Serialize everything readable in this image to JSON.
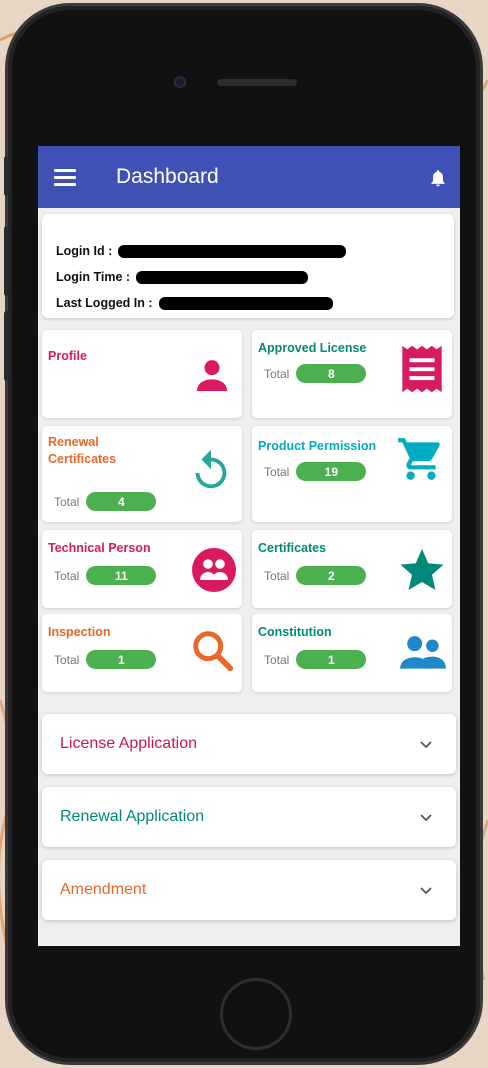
{
  "appbar": {
    "title": "Dashboard"
  },
  "info": {
    "login_id_label": "Login Id :",
    "login_time_label": "Login Time :",
    "last_logged_label": "Last Logged In :"
  },
  "tiles": [
    {
      "label": "Profile",
      "color": "#d81b60",
      "icon": "person-icon",
      "total_label": "",
      "total": ""
    },
    {
      "label": "Approved License",
      "color": "#00897b",
      "icon": "receipt-icon",
      "total_label": "Total",
      "total": "8"
    },
    {
      "label": "Renewal Certificates",
      "color": "#e8672a",
      "icon": "refresh-icon",
      "total_label": "Total",
      "total": "4"
    },
    {
      "label": "Product Permission",
      "color": "#00acc1",
      "icon": "cart-icon",
      "total_label": "Total",
      "total": "19"
    },
    {
      "label": "Technical Person",
      "color": "#d81b60",
      "icon": "face-icon",
      "total_label": "Total",
      "total": "11"
    },
    {
      "label": "Certificates",
      "color": "#00897b",
      "icon": "star-icon",
      "total_label": "Total",
      "total": "2"
    },
    {
      "label": "Inspection",
      "color": "#e8672a",
      "icon": "search-icon",
      "total_label": "Total",
      "total": "1"
    },
    {
      "label": "Constitution",
      "color": "#00897b",
      "icon": "people-icon",
      "total_label": "Total",
      "total": "1"
    }
  ],
  "accordion": [
    {
      "label": "License Application",
      "color": "#c2185b"
    },
    {
      "label": "Renewal Application",
      "color": "#00897b"
    },
    {
      "label": "Amendment",
      "color": "#e8672a"
    }
  ],
  "colors": {
    "appbar": "#3f51b5",
    "pill": "#4caf50"
  }
}
